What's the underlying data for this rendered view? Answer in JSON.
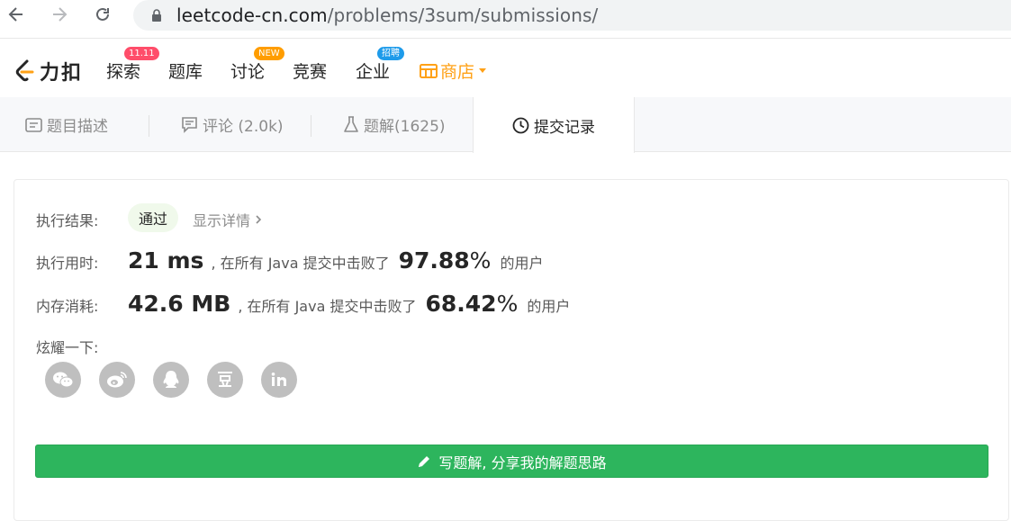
{
  "browser": {
    "url_host": "leetcode-cn.com",
    "url_path": "/problems/3sum/submissions/"
  },
  "header": {
    "brand": "力扣",
    "nav": [
      {
        "label": "探索",
        "badge": "11.11",
        "badge_color": "#ff4d6a"
      },
      {
        "label": "题库"
      },
      {
        "label": "讨论",
        "badge": "NEW",
        "badge_color": "#ff9d00"
      },
      {
        "label": "竞赛"
      },
      {
        "label": "企业",
        "badge": "招聘",
        "badge_color": "#1e9bea"
      },
      {
        "label": "商店"
      }
    ],
    "store_color": "#ffa116"
  },
  "tabs": [
    {
      "label": "题目描述",
      "icon": "description-icon"
    },
    {
      "label": "评论 (2.0k)",
      "icon": "comment-icon"
    },
    {
      "label": "题解(1625)",
      "icon": "flask-icon"
    },
    {
      "label": "提交记录",
      "icon": "clock-icon",
      "active": true
    }
  ],
  "result": {
    "label": "执行结果:",
    "status": "通过",
    "details": "显示详情",
    "runtime": {
      "label": "执行用时:",
      "value": "21 ms",
      "middle": ", 在所有 Java 提交中击败了",
      "percent": "97.88",
      "pct_sign": "%",
      "suffix": "的用户"
    },
    "memory": {
      "label": "内存消耗:",
      "value": "42.6 MB",
      "middle": ", 在所有 Java 提交中击败了",
      "percent": "68.42",
      "pct_sign": "%",
      "suffix": "的用户"
    },
    "share_label": "炫耀一下:",
    "share_icons": [
      "wechat-icon",
      "weibo-icon",
      "qq-icon",
      "douban-icon",
      "linkedin-icon"
    ],
    "write_button": "写题解, 分享我的解题思路",
    "accent_green": "#2db55d"
  }
}
